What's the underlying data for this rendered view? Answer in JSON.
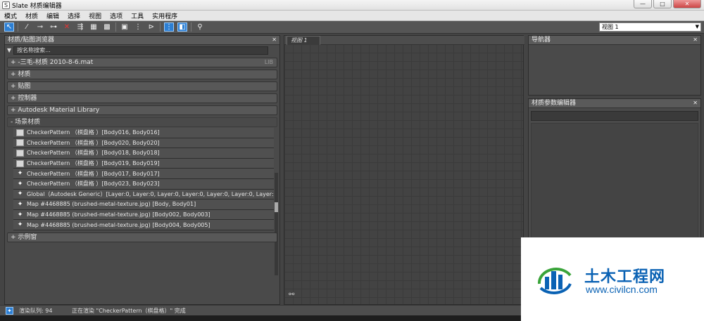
{
  "window": {
    "title": "Slate 材质编辑器",
    "buttons": {
      "minimize": "—",
      "maximize": "□",
      "close": "✕"
    }
  },
  "menu": [
    "模式",
    "材质",
    "编辑",
    "选择",
    "视图",
    "选项",
    "工具",
    "实用程序"
  ],
  "toolbar": {
    "view_select": "视图 1"
  },
  "browser": {
    "title": "材质/贴图浏览器",
    "search_placeholder": "按名称搜索...",
    "groups": {
      "file": "+ -三毛-材质 2010-8-6.mat",
      "file_tag": "LIB",
      "materials": "+ 材质",
      "maps": "+ 贴图",
      "controllers": "+ 控制器",
      "autodesk": "+ Autodesk Material Library",
      "scene": "- 场景材质",
      "sample": "+ 示例窗"
    },
    "scene_items": [
      {
        "icon": "swatch",
        "label": "CheckerPattern （棋盘格 ）[Body016, Body016]"
      },
      {
        "icon": "swatch",
        "label": "CheckerPattern （棋盘格 ）[Body020, Body020]"
      },
      {
        "icon": "swatch",
        "label": "CheckerPattern （棋盘格 ）[Body018, Body018]"
      },
      {
        "icon": "swatch",
        "label": "CheckerPattern （棋盘格 ）[Body019, Body019]"
      },
      {
        "icon": "map",
        "label": "CheckerPattern （棋盘格 ）[Body017, Body017]"
      },
      {
        "icon": "map",
        "label": "CheckerPattern （棋盘格 ）[Body023, Body023]"
      },
      {
        "icon": "map",
        "label": "Global（Autodesk Generic）[Layer:0, Layer:0, Layer:0, Layer:0, Layer:0, Layer:0, Layer:0,..."
      },
      {
        "icon": "map",
        "label": "Map #4468885 (brushed-metal-texture.jpg) [Body, Body01]"
      },
      {
        "icon": "map",
        "label": "Map #4468885 (brushed-metal-texture.jpg) [Body002, Body003]"
      },
      {
        "icon": "map",
        "label": "Map #4468885 (brushed-metal-texture.jpg) [Body004, Body005]"
      }
    ]
  },
  "view": {
    "tab_label": "视图 1"
  },
  "navigator": {
    "title": "导航器"
  },
  "params": {
    "title": "材质参数编辑器"
  },
  "status": {
    "queue": "渲染队列: 94",
    "message": "正在渲染 \"CheckerPattern（棋盘格）\" 完成"
  },
  "watermark": {
    "title": "土木工程网",
    "url": "www.civilcn.com"
  },
  "colors": {
    "accent": "#2d7fd3",
    "watermark_blue": "#0a62b4",
    "watermark_green": "#3aa43a"
  }
}
